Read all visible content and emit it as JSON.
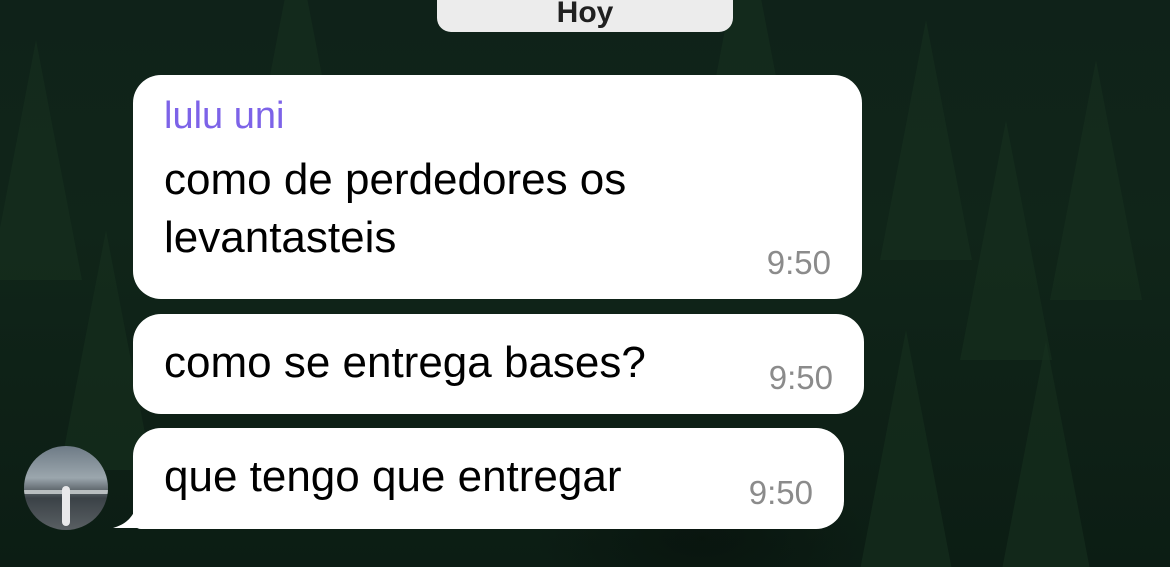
{
  "date_separator": "Hoy",
  "messages": [
    {
      "sender": "lulu uni",
      "text": "como de perdedores os levantasteis",
      "time": "9:50"
    },
    {
      "text": "como se entrega bases?",
      "time": "9:50"
    },
    {
      "text": "que tengo que entregar",
      "time": "9:50"
    }
  ],
  "colors": {
    "sender_name": "#7d63e8",
    "bubble": "#ffffff",
    "timestamp": "#8b8b8b",
    "date_pill": "#ececec"
  }
}
